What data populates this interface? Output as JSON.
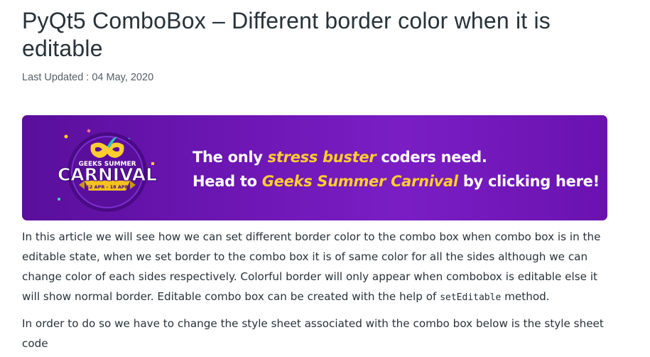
{
  "article": {
    "title": "PyQt5 ComboBox – Different border color when it is editable",
    "last_updated": "Last Updated : 04 May, 2020"
  },
  "banner": {
    "badge_top": "GEEKS SUMMER",
    "badge_main": "CARNIVAL",
    "badge_dates": "12 APR - 18 APR",
    "line1_pre": "The only ",
    "line1_highlight": "stress buster",
    "line1_post": " coders need.",
    "line2_pre": "Head to ",
    "line2_highlight": "Geeks Summer Carnival",
    "line2_post": " by clicking here!",
    "colors": {
      "background": "#6c16b3",
      "highlight": "#ffcd2e",
      "ribbon": "#f4c21f"
    }
  },
  "content": {
    "para1_text": "In this article we will see how we can set different border color to the combo box when combo box is in the editable state, when we set border to the combo box it is of same color for all the sides although we can change color of each sides respectively. Colorful border will only appear when combobox is editable else it will show normal border. Editable combo box can be created with the help of ",
    "para1_code": "setEditable",
    "para1_end": " method.",
    "para2": "In order to do so we have to change the style sheet associated with the combo box below is the style sheet code"
  }
}
